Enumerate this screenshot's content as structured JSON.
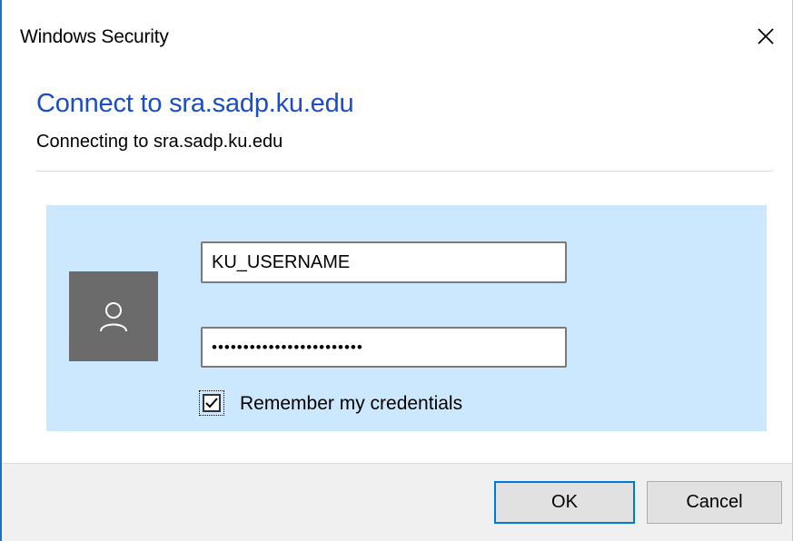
{
  "window": {
    "title": "Windows Security",
    "close_icon": "close-icon"
  },
  "dialog": {
    "heading": "Connect to sra.sadp.ku.edu",
    "subheading": "Connecting to sra.sadp.ku.edu"
  },
  "credentials": {
    "avatar_icon": "user-icon",
    "username_value": "KU_USERNAME",
    "password_value": "••••••••••••••••••••••••",
    "remember_checked": true,
    "remember_label": "Remember my credentials"
  },
  "buttons": {
    "ok_label": "OK",
    "cancel_label": "Cancel"
  },
  "colors": {
    "heading": "#1b4dc6",
    "panel_background": "#cce8ff",
    "avatar_background": "#6b6b6b",
    "default_button_border": "#0078d7"
  }
}
